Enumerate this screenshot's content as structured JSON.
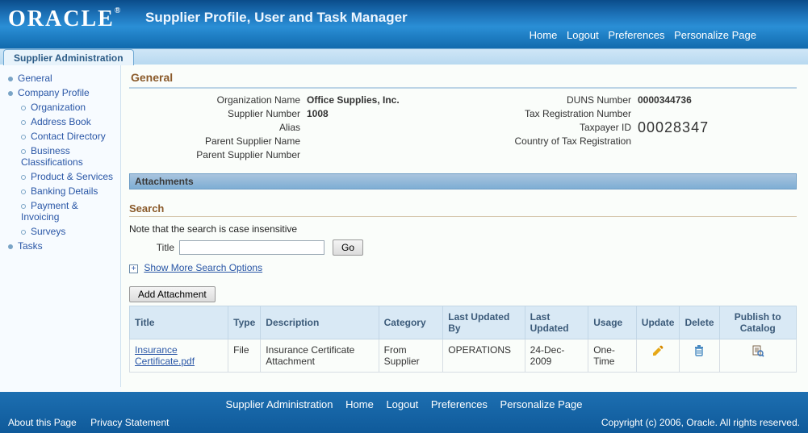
{
  "header": {
    "logo_text": "ORACLE",
    "logo_reg": "®",
    "app_title": "Supplier Profile, User and Task Manager",
    "nav": {
      "home": "Home",
      "logout": "Logout",
      "prefs": "Preferences",
      "personalize": "Personalize Page"
    }
  },
  "tab": {
    "label": "Supplier Administration"
  },
  "sidebar": {
    "general": "General",
    "company_profile": "Company Profile",
    "organization": "Organization",
    "address_book": "Address Book",
    "contact_dir": "Contact Directory",
    "biz_class": "Business Classifications",
    "prod_services": "Product & Services",
    "banking": "Banking Details",
    "payment": "Payment & Invoicing",
    "surveys": "Surveys",
    "tasks": "Tasks"
  },
  "page_title": "General",
  "info": {
    "org_name_label": "Organization Name",
    "org_name": "Office Supplies, Inc.",
    "supplier_number_label": "Supplier Number",
    "supplier_number": "1008",
    "alias_label": "Alias",
    "alias": "",
    "parent_name_label": "Parent Supplier Name",
    "parent_name": "",
    "parent_number_label": "Parent Supplier Number",
    "parent_number": "",
    "duns_label": "DUNS Number",
    "duns": "0000344736",
    "tax_reg_label": "Tax Registration Number",
    "tax_reg": "",
    "taxpayer_label": "Taxpayer ID",
    "taxpayer": "00028347",
    "country_tax_label": "Country of Tax Registration",
    "country_tax": ""
  },
  "attachments_header": "Attachments",
  "search": {
    "title": "Search",
    "note": "Note that the search is case insensitive",
    "title_label": "Title",
    "title_value": "",
    "go": "Go",
    "show_more": "Show More Search Options",
    "plus": "+"
  },
  "add_attachment": "Add Attachment",
  "table": {
    "headers": {
      "title": "Title",
      "type": "Type",
      "description": "Description",
      "category": "Category",
      "last_updated_by": "Last Updated By",
      "last_updated": "Last Updated",
      "usage": "Usage",
      "update": "Update",
      "delete": "Delete",
      "publish": "Publish to Catalog"
    },
    "row": {
      "title": "Insurance Certificate.pdf",
      "type": "File",
      "description": "Insurance Certificate Attachment",
      "category": "From Supplier",
      "last_updated_by": "OPERATIONS",
      "last_updated": "24-Dec-2009",
      "usage": "One-Time"
    }
  },
  "footer": {
    "links": {
      "admin": "Supplier Administration",
      "home": "Home",
      "logout": "Logout",
      "prefs": "Preferences",
      "personalize": "Personalize Page"
    },
    "about": "About this Page",
    "privacy": "Privacy Statement",
    "copyright": "Copyright (c) 2006, Oracle. All rights reserved."
  }
}
